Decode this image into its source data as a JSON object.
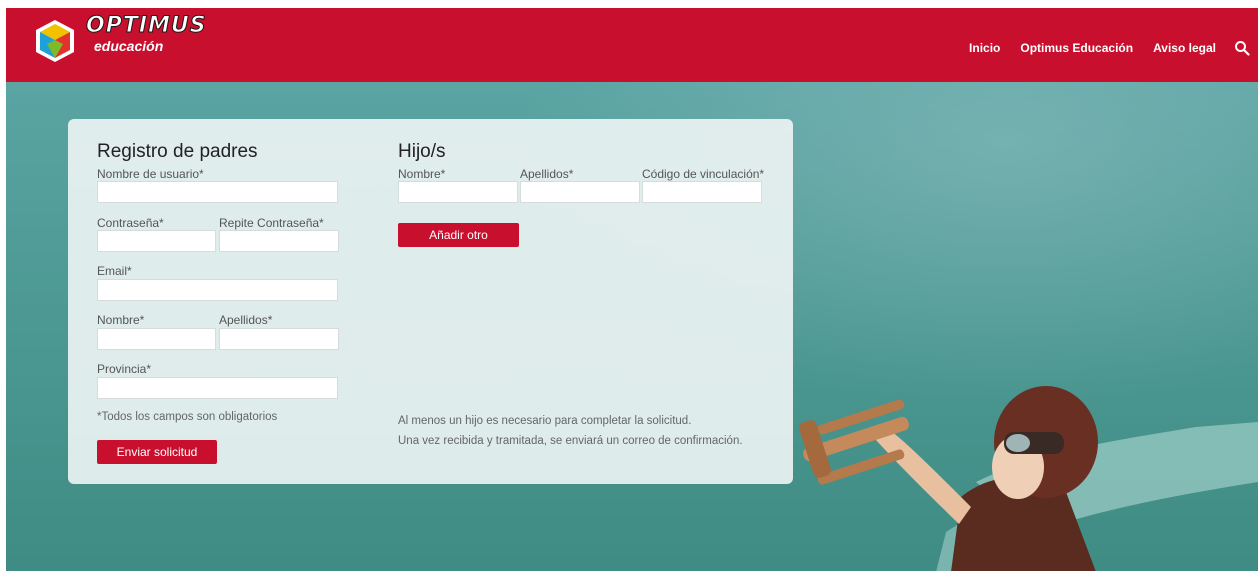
{
  "brand": {
    "name": "OPTIMUS",
    "sub": "educación"
  },
  "nav": {
    "items": [
      "Inicio",
      "Optimus Educación",
      "Aviso legal"
    ]
  },
  "parents": {
    "title": "Registro de padres",
    "username_label": "Nombre de usuario*",
    "password_label": "Contraseña*",
    "password_repeat_label": "Repite Contraseña*",
    "email_label": "Email*",
    "first_name_label": "Nombre*",
    "last_name_label": "Apellidos*",
    "province_label": "Provincia*",
    "required_note": "*Todos los campos son obligatorios",
    "submit_label": "Enviar solicitud"
  },
  "children": {
    "title": "Hijo/s",
    "first_name_label": "Nombre*",
    "last_name_label": "Apellidos*",
    "code_label": "Código de vinculación*",
    "add_label": "Añadir otro",
    "note_line1": "Al menos un hijo es necesario para completar la solicitud.",
    "note_line2": "Una vez recibida y tramitada, se enviará un correo de confirmación."
  },
  "colors": {
    "brand_red": "#c8102e",
    "hero_teal": "#4f9a95"
  },
  "icons": {
    "logo": "cube-logo-icon",
    "search": "search-icon"
  }
}
